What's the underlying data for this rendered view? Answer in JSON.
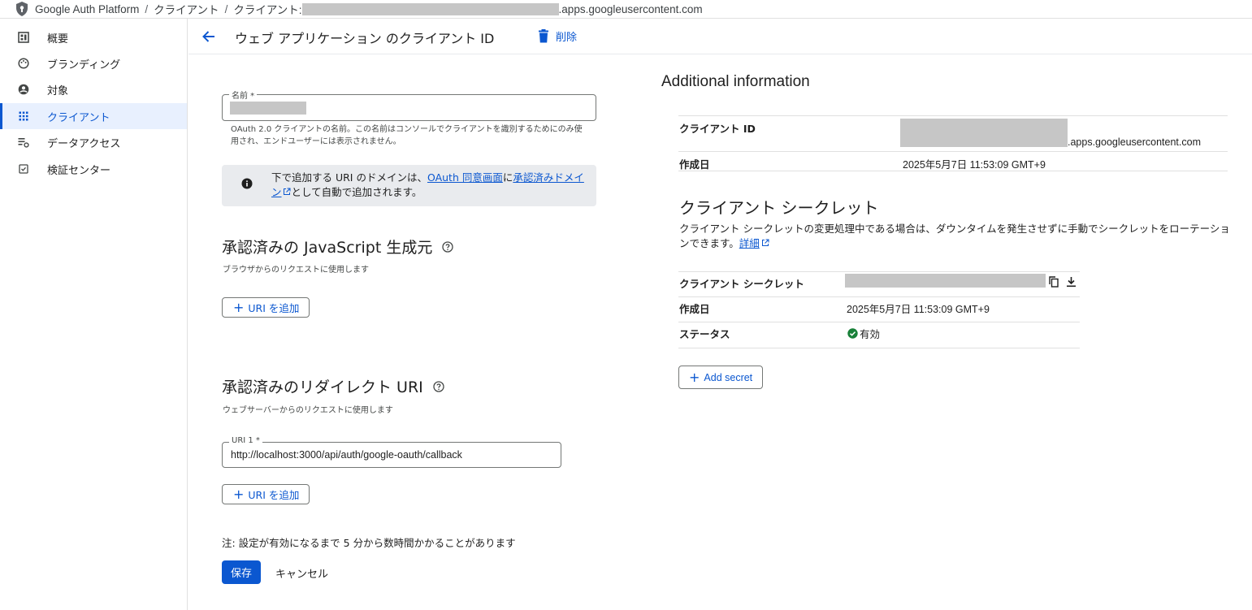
{
  "breadcrumb": {
    "app": "Google Auth Platform",
    "sep": "/",
    "section": "クライアント",
    "client_prefix": "クライアント:",
    "client_suffix": ".apps.googleusercontent.com"
  },
  "sidebar": {
    "items": [
      {
        "label": "概要",
        "icon": "dashboard-icon"
      },
      {
        "label": "ブランディング",
        "icon": "palette-icon"
      },
      {
        "label": "対象",
        "icon": "account-circle-icon"
      },
      {
        "label": "クライアント",
        "icon": "apps-grid-icon",
        "active": true
      },
      {
        "label": "データアクセス",
        "icon": "data-settings-icon"
      },
      {
        "label": "検証センター",
        "icon": "checkbox-icon"
      }
    ]
  },
  "header": {
    "title": "ウェブ アプリケーション のクライアント ID",
    "delete_label": "削除"
  },
  "form": {
    "name_label": "名前 *",
    "name_helper": "OAuth 2.0 クライアントの名前。この名前はコンソールでクライアントを識別するためにのみ使用され、エンドユーザーには表示されません。",
    "info_text_1": "下で追加する URI のドメインは、",
    "info_link_1": "OAuth 同意画面",
    "info_text_2": "に",
    "info_link_2": "承認済みドメイン",
    "info_text_3": "として自動で追加されます。",
    "js_origins_title": "承認済みの JavaScript 生成元",
    "js_origins_sub": "ブラウザからのリクエストに使用します",
    "add_uri_label": "URI を追加",
    "redirect_title": "承認済みのリダイレクト URI",
    "redirect_sub": "ウェブサーバーからのリクエストに使用します",
    "uri1_label": "URI 1 *",
    "uri1_value": "http://localhost:3000/api/auth/google-oauth/callback",
    "note": "注: 設定が有効になるまで 5 分から数時間かかることがあります",
    "save_label": "保存",
    "cancel_label": "キャンセル"
  },
  "additional": {
    "title": "Additional information",
    "client_id_key": "クライアント ID",
    "client_id_suffix": ".apps.googleusercontent.com",
    "created_key": "作成日",
    "created_value": "2025年5月7日 11:53:09 GMT+9"
  },
  "secret": {
    "title": "クライアント シークレット",
    "desc": "クライアント シークレットの変更処理中である場合は、ダウンタイムを発生させずに手動でシークレットをローテーションできます。",
    "desc_link": "詳細",
    "secret_key": "クライアント シークレット",
    "created_key": "作成日",
    "created_value": "2025年5月7日 11:53:09 GMT+9",
    "status_key": "ステータス",
    "status_value": "有効",
    "add_secret_label": "Add secret"
  },
  "colors": {
    "accent": "#0b57d0",
    "active_bg": "#e8f0fe",
    "status_ok": "#188038"
  }
}
